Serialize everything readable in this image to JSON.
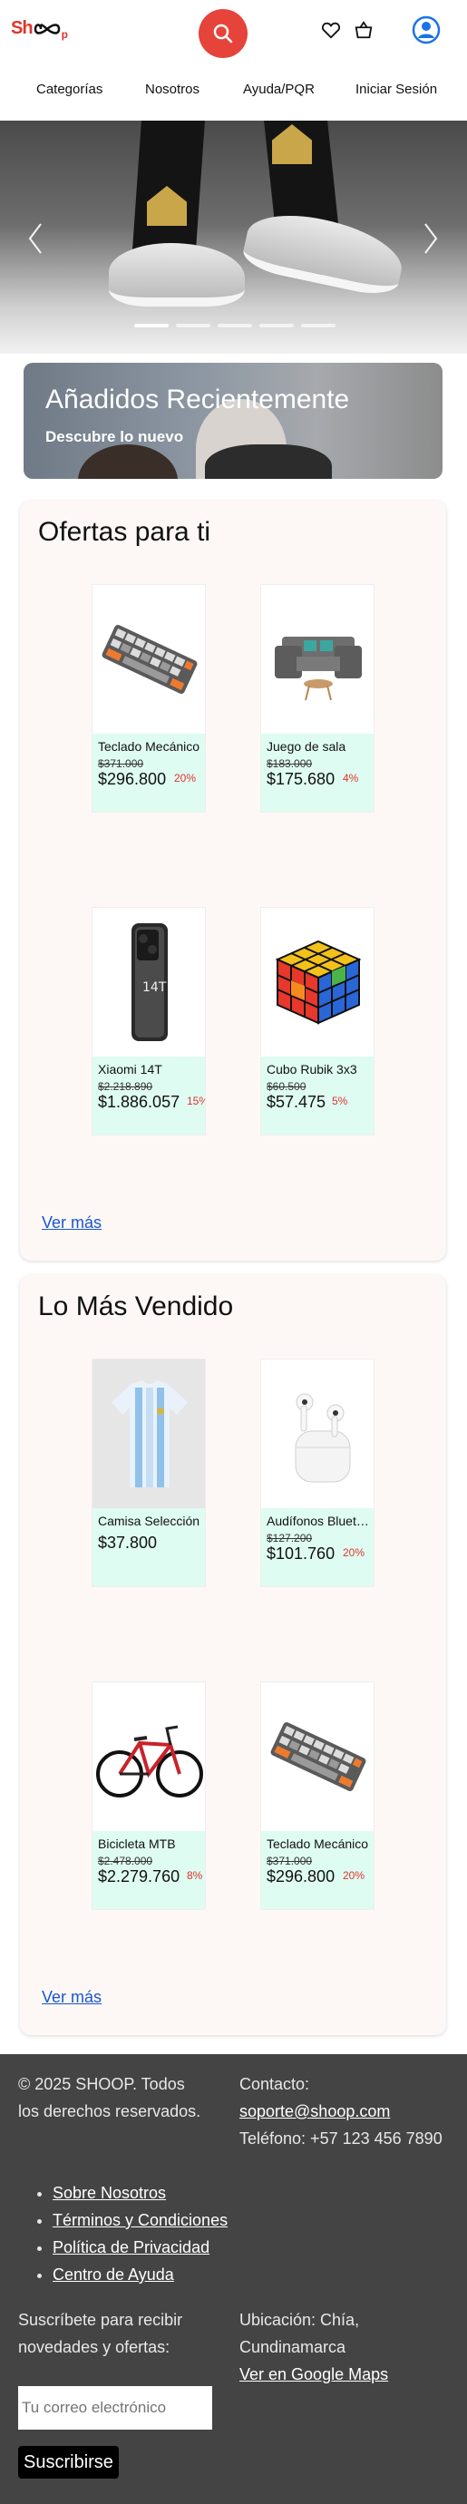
{
  "header": {
    "logo_left": "Sh",
    "logo_right": "p",
    "icons": [
      "search-icon",
      "heart-icon",
      "basket-icon",
      "user-icon"
    ],
    "accent_color": "#e6433a"
  },
  "nav": [
    "Categorías",
    "Nosotros",
    "Ayuda/PQR",
    "Iniciar Sesión"
  ],
  "hero": {
    "slides": 5,
    "active_slide": 1
  },
  "banner": {
    "title": "Añadidos Recientemente",
    "subtitle": "Descubre lo nuevo"
  },
  "ofertas": {
    "title": "Ofertas para ti",
    "more": "Ver más",
    "products": [
      {
        "name": "Teclado Mecánico",
        "old": "$371.000",
        "price": "$296.800",
        "discount": "20%"
      },
      {
        "name": "Juego de sala",
        "old": "$183.000",
        "price": "$175.680",
        "discount": "4%"
      },
      {
        "name": "Xiaomi 14T",
        "old": "$2.218.890",
        "price": "$1.886.057",
        "discount": "15%"
      },
      {
        "name": "Cubo Rubik 3x3",
        "old": "$60.500",
        "price": "$57.475",
        "discount": "5%"
      }
    ]
  },
  "vendido": {
    "title": "Lo Más Vendido",
    "more": "Ver más",
    "products": [
      {
        "name": "Camisa Selección",
        "old": "",
        "price": "$37.800",
        "discount": ""
      },
      {
        "name": "Audífonos Bluetooth",
        "old": "$127.200",
        "price": "$101.760",
        "discount": "20%"
      },
      {
        "name": "Bicicleta MTB",
        "old": "$2.478.000",
        "price": "$2.279.760",
        "discount": "8%"
      },
      {
        "name": "Teclado Mecánico",
        "old": "$371.000",
        "price": "$296.800",
        "discount": "20%"
      }
    ]
  },
  "footer": {
    "copyright": "© 2025 SHOOP. Todos los derechos reservados.",
    "contact_label": "Contacto:",
    "email": "soporte@shoop.com",
    "phone": "Teléfono: +57 123 456 7890",
    "links": [
      "Sobre Nosotros",
      "Términos y Condiciones",
      "Política de Privacidad",
      "Centro de Ayuda"
    ],
    "subscribe_text": "Suscríbete para recibir novedades y ofertas:",
    "location": "Ubicación: Chía, Cundinamarca",
    "maps_link": "Ver en Google Maps",
    "email_placeholder": "Tu correo electrónico",
    "subscribe_button": "Suscribirse"
  }
}
